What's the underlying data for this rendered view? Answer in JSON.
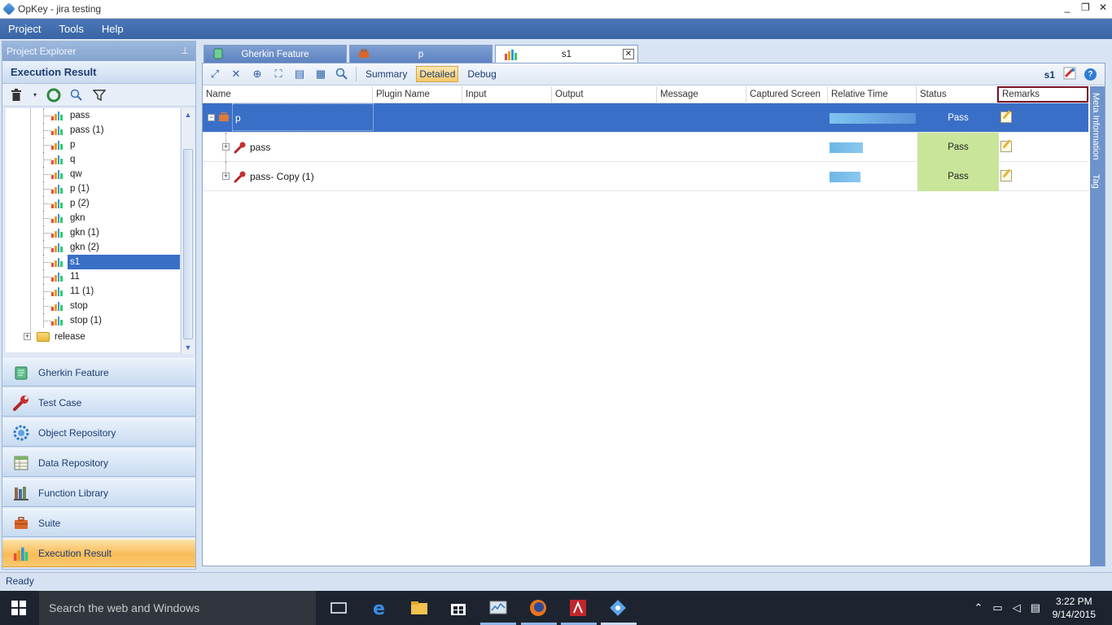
{
  "window": {
    "title": "OpKey - jira testing",
    "min": "_",
    "max": "❐",
    "close": "✕"
  },
  "menu": [
    "Project",
    "Tools",
    "Help"
  ],
  "project_explorer": {
    "title": "Project Explorer",
    "pin": "📌",
    "section_title": "Execution Result",
    "tree_items": [
      {
        "label": "pass"
      },
      {
        "label": "pass (1)"
      },
      {
        "label": "p"
      },
      {
        "label": "q"
      },
      {
        "label": "qw"
      },
      {
        "label": "p (1)"
      },
      {
        "label": "p (2)"
      },
      {
        "label": "gkn"
      },
      {
        "label": "gkn (1)"
      },
      {
        "label": "gkn (2)"
      },
      {
        "label": "s1",
        "selected": true
      },
      {
        "label": "11"
      },
      {
        "label": "11 (1)"
      },
      {
        "label": "stop"
      },
      {
        "label": "stop (1)"
      }
    ],
    "folder": {
      "label": "release",
      "expander": "+"
    }
  },
  "nav": [
    {
      "label": "Gherkin Feature",
      "icon": "scroll-icon"
    },
    {
      "label": "Test Case",
      "icon": "wrench-icon"
    },
    {
      "label": "Object Repository",
      "icon": "gear-icon"
    },
    {
      "label": "Data Repository",
      "icon": "database-icon"
    },
    {
      "label": "Function Library",
      "icon": "library-icon"
    },
    {
      "label": "Suite",
      "icon": "briefcase-icon"
    },
    {
      "label": "Execution Result",
      "icon": "bar-chart-icon",
      "active": true
    }
  ],
  "tabs": [
    {
      "label": "Gherkin Feature",
      "active": false
    },
    {
      "label": "p",
      "active": false
    },
    {
      "label": "s1",
      "active": true,
      "close": "✕"
    }
  ],
  "toolbar": {
    "summary": "Summary",
    "detailed": "Detailed",
    "debug": "Debug",
    "current": "s1",
    "help": "?"
  },
  "grid": {
    "columns": [
      "Name",
      "Plugin Name",
      "Input",
      "Output",
      "Message",
      "Captured Screen",
      "Relative Time",
      "Status",
      "Remarks"
    ],
    "rows": [
      {
        "name": "p",
        "status": "Pass",
        "time_fraction": 1.0,
        "selected": true,
        "expander": "−"
      },
      {
        "name": "pass",
        "status": "Pass",
        "time_fraction": 0.39,
        "expander": "+"
      },
      {
        "name": "pass- Copy (1)",
        "status": "Pass",
        "time_fraction": 0.36,
        "expander": "+"
      }
    ]
  },
  "side_tabs": [
    "Meta Information",
    "Tag"
  ],
  "statusbar": {
    "text": "Ready"
  },
  "taskbar": {
    "search_placeholder": "Search the web and Windows",
    "time": "3:22 PM",
    "date": "9/14/2015"
  },
  "colors": {
    "accent": "#3a6fc7",
    "pass_bg": "#c9e59a",
    "active_nav": "#f9bb5a",
    "remarks_highlight": "#7a1023"
  }
}
